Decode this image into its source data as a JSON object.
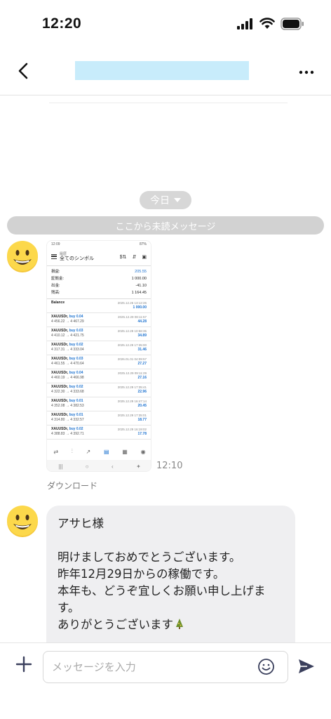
{
  "status_bar": {
    "time": "12:20"
  },
  "header": {
    "title": ""
  },
  "chat": {
    "date_label": "今日",
    "unread_label": "ここから未読メッセージ",
    "image_message": {
      "time": "12:10",
      "download_label": "ダウンロード",
      "screenshot": {
        "status_left": "12:09",
        "status_right": "87%",
        "sub_title": "履歴",
        "title": "全てのシンボル",
        "summary": [
          {
            "label": "損益:",
            "value": "205.55",
            "accent": true
          },
          {
            "label": "証拠金:",
            "value": "1 000.00"
          },
          {
            "label": "出金:",
            "value": "-41.10"
          },
          {
            "label": "残高:",
            "value": "1 164.45"
          }
        ],
        "balance": {
          "label": "Balance",
          "date": "2025.12.26 13:12:26",
          "value": "1 000.00"
        },
        "trades": [
          {
            "symbol": "XAUUSDr,",
            "side": "buy 0.04",
            "prices": "4 456.22 → 4 467.29",
            "date": "2025.12.29 08:11:57",
            "profit": "44.28"
          },
          {
            "symbol": "XAUUSDr,",
            "side": "buy 0.03",
            "prices": "4 410.12 → 4 421.75",
            "date": "2025.12.29 10:58:35",
            "profit": "34.89"
          },
          {
            "symbol": "XAUUSDr,",
            "side": "buy 0.02",
            "prices": "4 317.31 → 4 333.04",
            "date": "2025.12.29 17:35:00",
            "profit": "31.46"
          },
          {
            "symbol": "XAUUSDr,",
            "side": "buy 0.03",
            "prices": "4 461.55 → 4 470.64",
            "date": "2026.01.01 04:09:57",
            "profit": "27.27"
          },
          {
            "symbol": "XAUUSDr,",
            "side": "buy 0.04",
            "prices": "4 460.19 → 4 466.98",
            "date": "2025.12.29 09:11:29",
            "profit": "27.16"
          },
          {
            "symbol": "XAUUSDr,",
            "side": "buy 0.02",
            "prices": "4 322.30 → 4 333.68",
            "date": "2025.12.29 17:35:41",
            "profit": "22.96"
          },
          {
            "symbol": "XAUUSDr,",
            "side": "buy 0.01",
            "prices": "4 352.08 → 4 382.53",
            "date": "2025.12.29 16:47:14",
            "profit": "20.45"
          },
          {
            "symbol": "XAUUSDr,",
            "side": "buy 0.01",
            "prices": "4 314.80 → 4 332.57",
            "date": "2025.12.29 17:35:01",
            "profit": "18.77"
          },
          {
            "symbol": "XAUUSDr,",
            "side": "buy 0.02",
            "prices": "4 388.83 → 4 392.71",
            "date": "2025.12.29 16:19:02",
            "profit": "17.78"
          }
        ]
      }
    },
    "text_message": {
      "lines": [
        "アサヒ様",
        "",
        "明けましておめでとうございます。",
        "昨年12月29日からの稼働です。",
        "本年も、どうぞ宜しくお願い申し上げま",
        "す。",
        "ありがとうございます"
      ]
    }
  },
  "input": {
    "placeholder": "メッセージを入力",
    "value": ""
  },
  "colors": {
    "title_highlight": "#c8ecfb",
    "pill": "#d7d7d7",
    "bubble": "#efeff1",
    "send": "#3a3f5c"
  },
  "icons": [
    "back-icon",
    "more-icon",
    "plus-icon",
    "emoji-icon",
    "send-icon"
  ]
}
